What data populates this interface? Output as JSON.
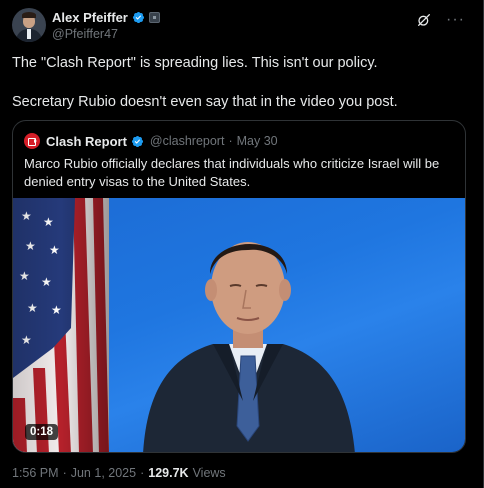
{
  "author": {
    "display_name": "Alex Pfeiffer",
    "handle": "@Pfeiffer47"
  },
  "post": {
    "paragraphs": [
      "The \"Clash Report\" is spreading lies. This isn't our policy.",
      "Secretary Rubio doesn't even say that in the video you post."
    ]
  },
  "quote": {
    "display_name": "Clash Report",
    "handle": "@clashreport",
    "separator": "·",
    "date": "May 30",
    "text": "Marco Rubio officially declares that individuals who criticize Israel will be denied entry visas to the United States.",
    "video": {
      "duration": "0:18"
    }
  },
  "meta": {
    "time": "1:56 PM",
    "separator": "·",
    "date": "Jun 1, 2025",
    "separator2": "·",
    "views_count": "129.7K",
    "views_label": "Views"
  },
  "colors": {
    "background": "#000000",
    "text_primary": "#e7e9ea",
    "text_secondary": "#71767b",
    "verified_blue": "#1d9bf0",
    "border": "#2f3336",
    "video_blue": "#1f76e0"
  },
  "icons": [
    "verified-badge-icon",
    "affiliate-badge-icon",
    "grok-icon",
    "more-icon",
    "flag-image",
    "play-duration-badge"
  ]
}
